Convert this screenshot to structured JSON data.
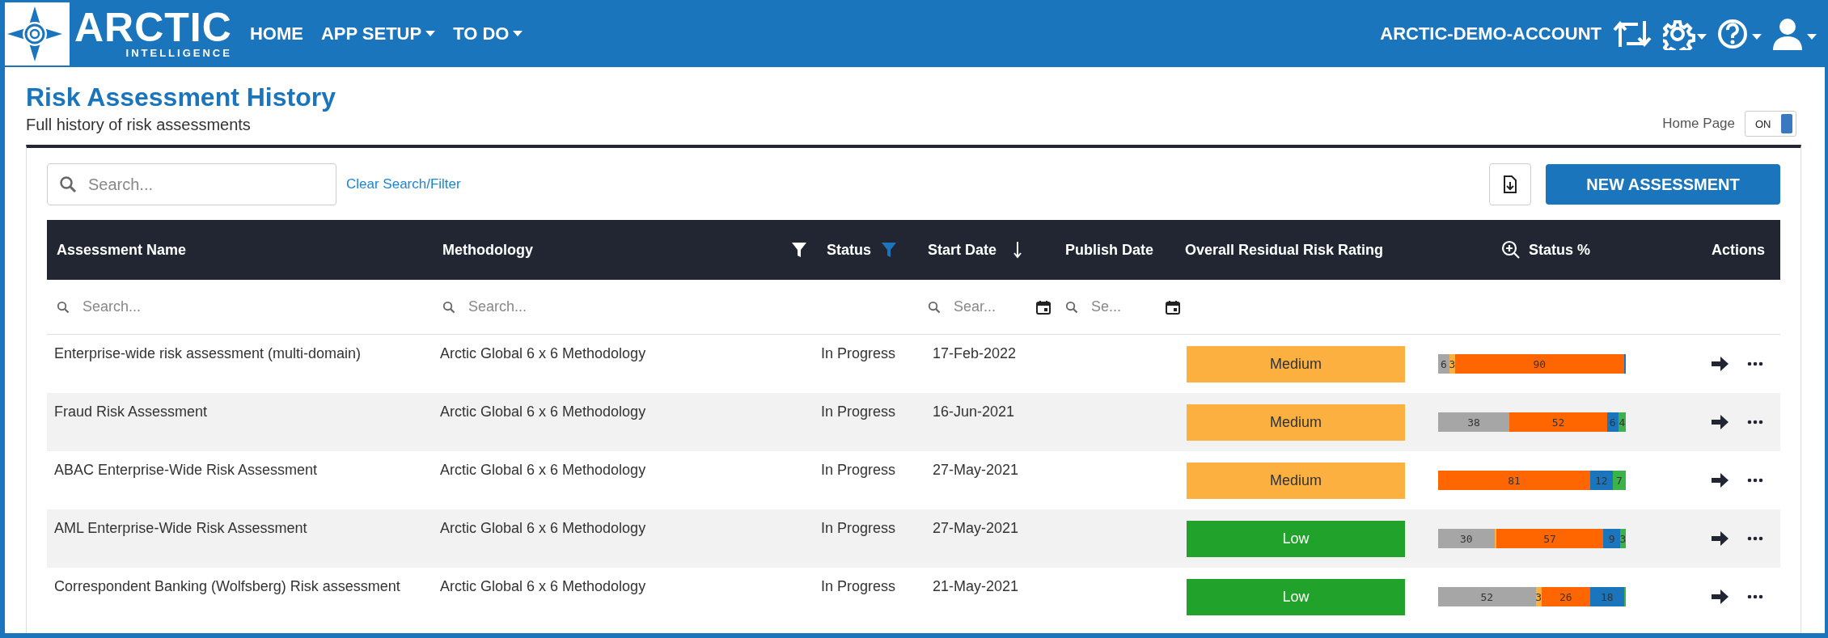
{
  "logo": {
    "name": "ARCTIC",
    "tagline": "INTELLIGENCE"
  },
  "nav": [
    {
      "label": "HOME",
      "dropdown": false
    },
    {
      "label": "APP SETUP",
      "dropdown": true
    },
    {
      "label": "TO DO",
      "dropdown": true
    }
  ],
  "account": "ARCTIC-DEMO-ACCOUNT",
  "page": {
    "title": "Risk Assessment History",
    "subtitle": "Full history of risk assessments"
  },
  "home_page_toggle": {
    "label": "Home Page",
    "state_text": "ON",
    "on": true
  },
  "search": {
    "placeholder": "Search..."
  },
  "clear_link": "Clear Search/Filter",
  "new_button": "NEW ASSESSMENT",
  "table": {
    "columns": [
      {
        "label": "Assessment Name",
        "kind": "text",
        "filter_placeholder": "Search..."
      },
      {
        "label": "Methodology",
        "kind": "text",
        "filter_placeholder": "Search...",
        "filter_active": false
      },
      {
        "label": "Status",
        "kind": "plain",
        "filter_active": true
      },
      {
        "label": "Start Date",
        "kind": "date",
        "filter_placeholder": "Sear...",
        "sort_descending": true
      },
      {
        "label": "Publish Date",
        "kind": "date",
        "filter_placeholder": "Se..."
      },
      {
        "label": "Overall Residual Risk Rating",
        "kind": "plain"
      },
      {
        "label": "Status %",
        "kind": "zoom"
      },
      {
        "label": "Actions",
        "kind": "plain"
      }
    ],
    "rows": [
      {
        "name": "Enterprise-wide risk assessment (multi-domain)",
        "methodology": "Arctic Global 6 x 6 Methodology",
        "status": "In Progress",
        "start_date": "17-Feb-2022",
        "rating": {
          "label": "Medium",
          "color": "#fbb040"
        },
        "progress": [
          {
            "label": "6",
            "color": "#a6a6a6"
          },
          {
            "label": "3",
            "color": "#fbb040"
          },
          {
            "label": "90",
            "color": "#ff6600"
          },
          {
            "color": "#1b75bc"
          }
        ]
      },
      {
        "name": "Fraud Risk Assessment",
        "methodology": "Arctic Global 6 x 6 Methodology",
        "status": "In Progress",
        "start_date": "16-Jun-2021",
        "rating": {
          "label": "Medium",
          "color": "#fbb040"
        },
        "progress": [
          {
            "label": "38",
            "color": "#a6a6a6"
          },
          {
            "label": "52",
            "color": "#ff6600"
          },
          {
            "label": "6",
            "color": "#1b75bc"
          },
          {
            "label": "4",
            "color": "#3cb34a"
          }
        ]
      },
      {
        "name": "ABAC Enterprise-Wide Risk Assessment",
        "methodology": "Arctic Global 6 x 6 Methodology",
        "status": "In Progress",
        "start_date": "27-May-2021",
        "rating": {
          "label": "Medium",
          "color": "#fbb040"
        },
        "progress": [
          {
            "label": "81",
            "color": "#ff6600"
          },
          {
            "label": "12",
            "color": "#1b75bc"
          },
          {
            "label": "7",
            "color": "#3cb34a"
          }
        ]
      },
      {
        "name": "AML Enterprise-Wide Risk Assessment",
        "methodology": "Arctic Global 6 x 6 Methodology",
        "status": "In Progress",
        "start_date": "27-May-2021",
        "rating": {
          "label": "Low",
          "color": "#21a32b"
        },
        "progress": [
          {
            "label": "30",
            "color": "#a6a6a6"
          },
          {
            "color": "#fbb040"
          },
          {
            "label": "57",
            "color": "#ff6600"
          },
          {
            "label": "9",
            "color": "#1b75bc"
          },
          {
            "label": "3",
            "color": "#3cb34a"
          }
        ]
      },
      {
        "name": "Correspondent Banking (Wolfsberg) Risk assessment",
        "methodology": "Arctic Global 6 x 6 Methodology",
        "status": "In Progress",
        "start_date": "21-May-2021",
        "rating": {
          "label": "Low",
          "color": "#21a32b"
        },
        "progress": [
          {
            "label": "52",
            "color": "#a6a6a6"
          },
          {
            "label": "3",
            "color": "#fbb040"
          },
          {
            "label": "26",
            "color": "#ff6600"
          },
          {
            "label": "18",
            "color": "#1b75bc"
          },
          {
            "color": "#3cb34a"
          }
        ]
      }
    ]
  }
}
